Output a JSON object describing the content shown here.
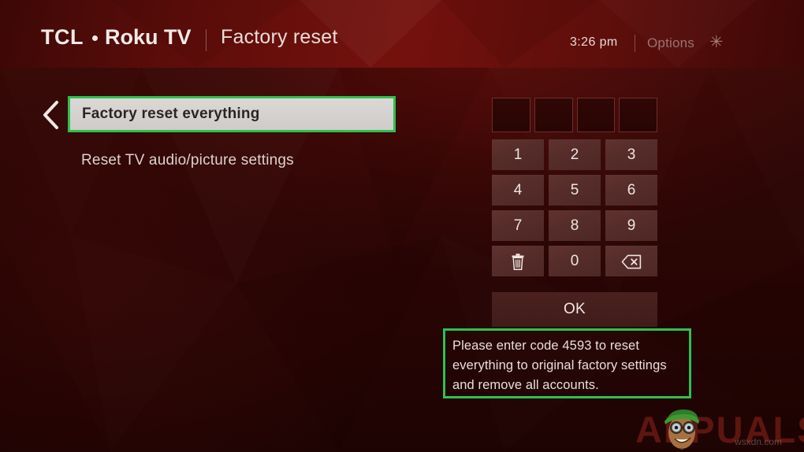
{
  "header": {
    "brand_tcl": "TCL",
    "brand_roku": "Roku TV",
    "separator": "|",
    "title": "Factory reset",
    "clock": "3:26 pm",
    "separator2": "|",
    "options_label": "Options",
    "options_icon": "asterisk-icon",
    "asterisk_glyph": "✳"
  },
  "nav": {
    "back_icon": "chevron-left-icon"
  },
  "menu": {
    "items": [
      {
        "label": "Factory reset everything",
        "selected": true
      },
      {
        "label": "Reset TV audio/picture settings",
        "selected": false
      }
    ]
  },
  "keypad": {
    "code_boxes": [
      "",
      "",
      "",
      ""
    ],
    "keys": [
      {
        "label": "1",
        "icon": null
      },
      {
        "label": "2",
        "icon": null
      },
      {
        "label": "3",
        "icon": null
      },
      {
        "label": "4",
        "icon": null
      },
      {
        "label": "5",
        "icon": null
      },
      {
        "label": "6",
        "icon": null
      },
      {
        "label": "7",
        "icon": null
      },
      {
        "label": "8",
        "icon": null
      },
      {
        "label": "9",
        "icon": null
      },
      {
        "label": "",
        "icon": "trash-icon"
      },
      {
        "label": "0",
        "icon": null
      },
      {
        "label": "",
        "icon": "backspace-icon"
      }
    ],
    "ok_label": "OK"
  },
  "note": {
    "text": "Please enter code 4593 to reset everything to original factory settings and remove all accounts.",
    "code": "4593"
  },
  "watermark": {
    "text": "APPUALS",
    "sub": "wsxdn.com"
  },
  "colors": {
    "background": "#2a0604",
    "header": "#74110d",
    "annotation_green": "#2fc04f",
    "selected_item_bg": "#d6d2cf",
    "key_bg": "#552c29",
    "text_light": "#e9dedb"
  }
}
